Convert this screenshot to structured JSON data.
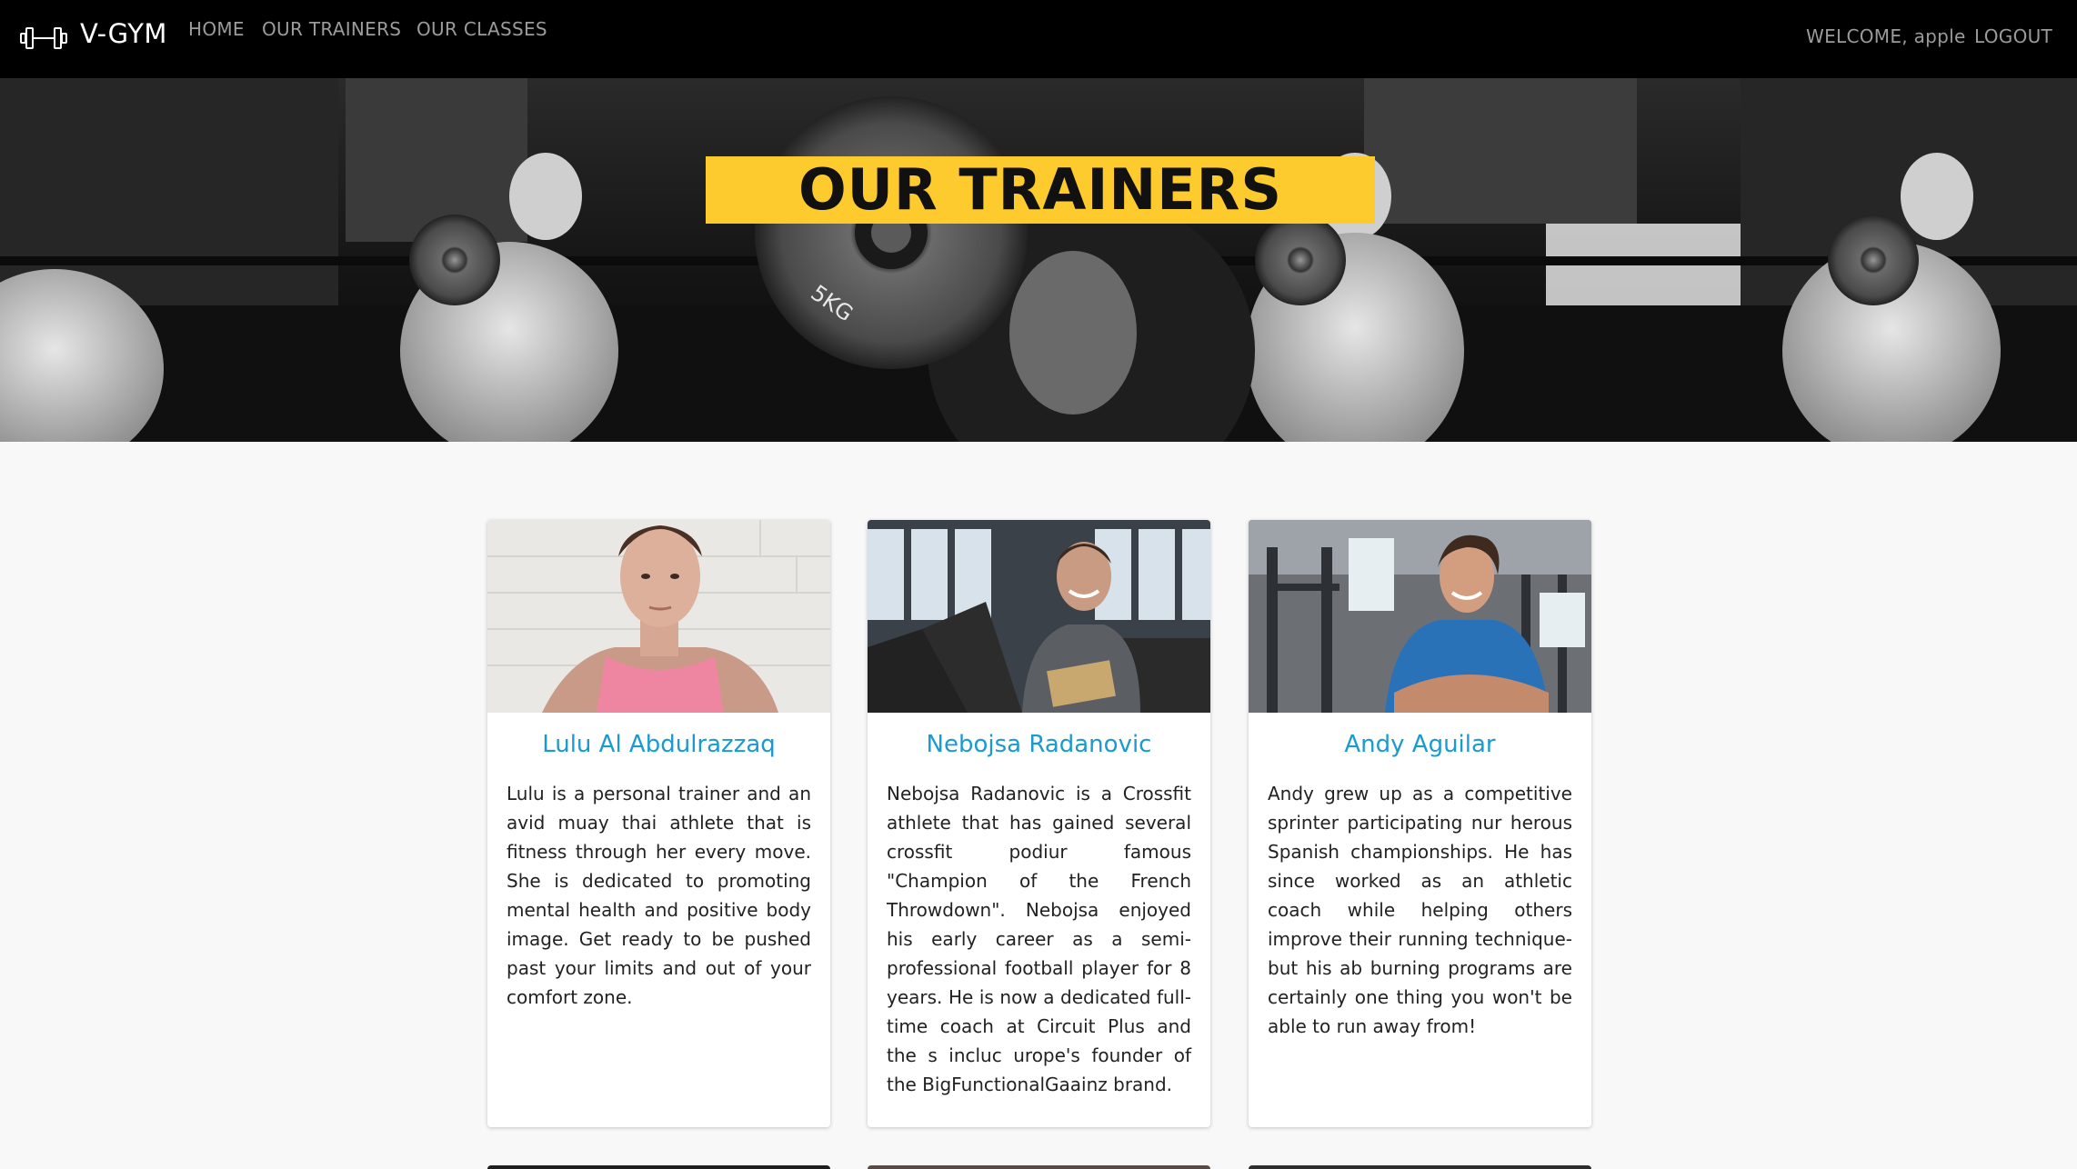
{
  "nav": {
    "brand": "V-GYM",
    "links": {
      "home": "HOME",
      "trainers": "OUR TRAINERS",
      "classes": "OUR CLASSES"
    },
    "welcome": "WELCOME, apple",
    "logout": "LOGOUT"
  },
  "hero": {
    "title": "OUR TRAINERS",
    "plate_label": "5KG"
  },
  "trainers": [
    {
      "name": "Lulu Al Abdulrazzaq",
      "bio": "Lulu is a personal trainer and an avid muay thai athlete that is fitness through her every move. She is dedicated to promoting mental health and positive body image. Get ready to be pushed past your limits and out of your comfort zone."
    },
    {
      "name": "Nebojsa Radanovic",
      "bio": "Nebojsa Radanovic is a Crossfit athlete that has gained several crossfit podiur famous \"Champion of the French Throwdown\". Nebojsa enjoyed his early career as a semi- professional football player for 8 years. He is now a dedicated full-time coach at Circuit Plus and the s incluc urope's founder of the BigFunctionalGaainz brand."
    },
    {
      "name": "Andy Aguilar",
      "bio": "Andy grew up as a competitive sprinter participating nur herous Spanish championships. He has since worked as an athletic coach while helping others improve their running technique- but his ab burning programs are certainly one thing you won't be able to run away from!"
    }
  ],
  "colors": {
    "accent": "#fdcb2d",
    "name_link": "#1b9ad0",
    "navbar": "#000000"
  }
}
